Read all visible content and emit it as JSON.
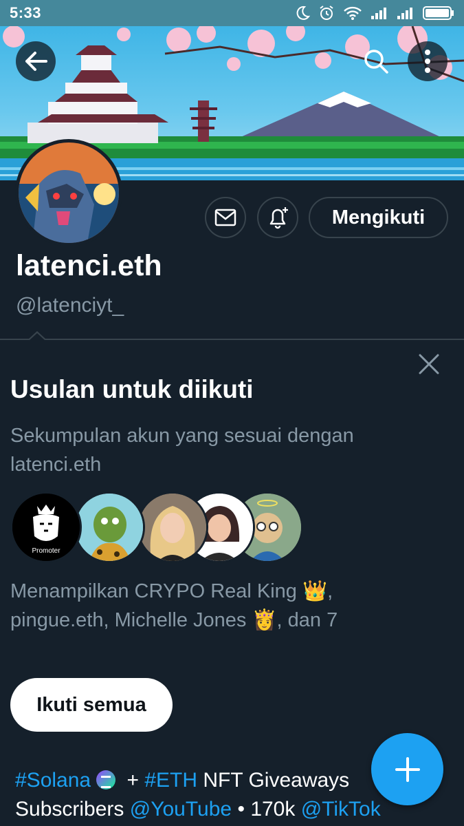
{
  "status_bar": {
    "time": "5:33"
  },
  "profile": {
    "display_name": "latenci.eth",
    "handle": "@latenciyt_",
    "follow_button_label": "Mengikuti"
  },
  "suggestions": {
    "title": "Usulan untuk diikuti",
    "description": "Sekumpulan akun yang sesuai dengan latenci.eth",
    "avatar_1_caption": "Promoter",
    "showing_text": "Menampilkan CRYPO Real King 👑, pingue.eth, Michelle Jones 👸, dan 7",
    "follow_all_label": "Ikuti semua"
  },
  "bio": {
    "tag_solana": "#Solana",
    "plus": "+",
    "tag_eth": "#ETH",
    "text_1": "NFT Giveaways",
    "text_2": "Subscribers",
    "mention_youtube": "@YouTube",
    "separator": "•",
    "count": "170k",
    "mention_tiktok": "@TikTok"
  },
  "colors": {
    "background": "#15202b",
    "accent": "#1da1f2",
    "secondary_text": "#8899a6",
    "border": "#38444d",
    "status_bar": "#45889b"
  },
  "icons": [
    "back-arrow-icon",
    "search-icon",
    "more-vertical-icon",
    "mail-icon",
    "bell-plus-icon",
    "close-icon",
    "compose-plus-icon"
  ]
}
